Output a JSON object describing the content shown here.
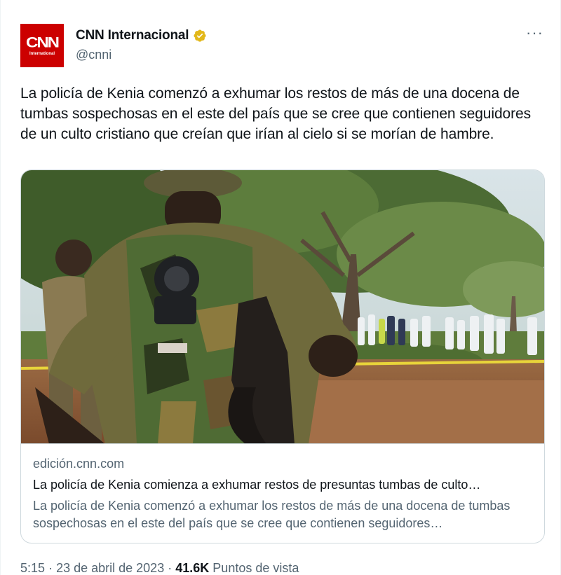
{
  "account": {
    "display_name": "CNN Internacional",
    "handle": "@cnni",
    "avatar_logo_text": "CNN",
    "avatar_logo_subtext": "International",
    "brand_color": "#cc0000",
    "verified_badge_color": "#e2b719",
    "more_menu_icon": "more-horizontal-icon"
  },
  "tweet": {
    "text": "La policía de Kenia comenzó a exhumar los restos de más de una docena de tumbas sospechosas en el este del país que se cree que contienen seguidores de un culto cristiano que creían que irían al cielo si se morían de hambre."
  },
  "card": {
    "domain": "edición.cnn.com",
    "title": "La policía de Kenia comienza a exhumar restos de presuntas tumbas de culto…",
    "description": "La policía de Kenia comenzó a exhumar los restos de más de una docena de tumbas sospechosas en el este del país que se cree que contienen seguidores…"
  },
  "meta": {
    "time": "5:15",
    "separator": "·",
    "date": "23 de abril de 2023",
    "views_count": "41.6K",
    "views_label": "Puntos de vista"
  },
  "colors": {
    "text_primary": "#0f1419",
    "text_secondary": "#536471",
    "border": "#cfd9de"
  }
}
